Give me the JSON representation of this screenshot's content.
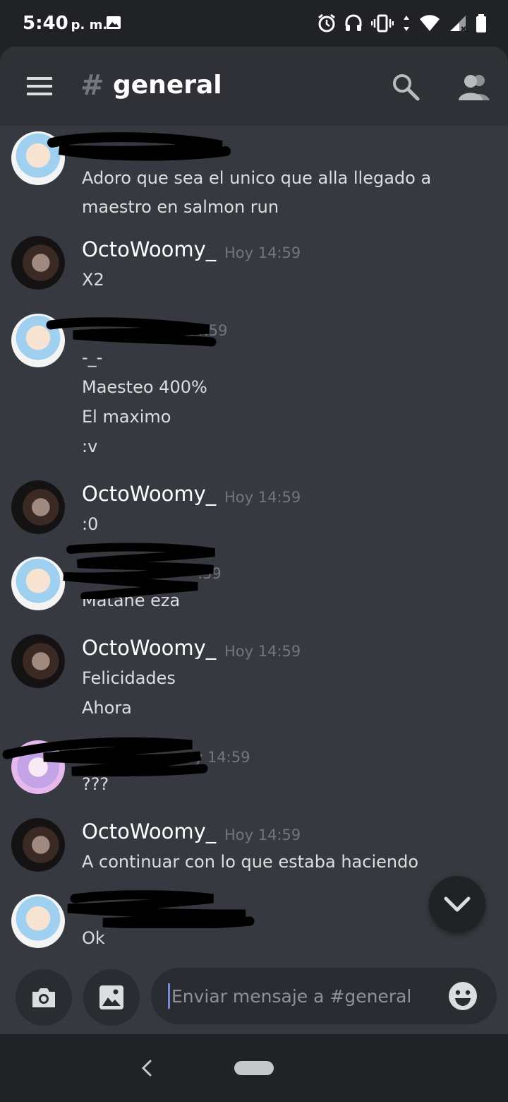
{
  "status_bar": {
    "time": "5:40",
    "ampm": "p. m."
  },
  "header": {
    "hash": "#",
    "channel": "general"
  },
  "messages": [
    {
      "author": "",
      "time": "",
      "lines": [
        "Adoro que sea el unico que alla llegado a",
        "maestro en salmon run"
      ]
    },
    {
      "author": "OctoWoomy_",
      "time": "Hoy 14:59",
      "lines": [
        "X2"
      ]
    },
    {
      "author": "",
      "time": "14:59",
      "lines": [
        "-_-",
        "Maesteo 400%",
        "El maximo",
        ":v"
      ]
    },
    {
      "author": "OctoWoomy_",
      "time": "Hoy 14:59",
      "lines": [
        ":0"
      ]
    },
    {
      "author": "",
      "time": ":59",
      "lines": [
        "Matane eza"
      ]
    },
    {
      "author": "OctoWoomy_",
      "time": "Hoy 14:59",
      "lines": [
        "Felicidades",
        "Ahora"
      ]
    },
    {
      "author": "",
      "time": "oy 14:59",
      "lines": [
        "???"
      ]
    },
    {
      "author": "OctoWoomy_",
      "time": "Hoy 14:59",
      "lines": [
        "A continuar con lo que estaba haciendo"
      ]
    },
    {
      "author": "",
      "time": "",
      "lines": [
        "Ok"
      ]
    }
  ],
  "composer": {
    "placeholder": "Enviar mensaje a #general"
  },
  "icons": {
    "menu": "hamburger-menu-icon",
    "search": "search-icon",
    "members": "members-icon",
    "camera": "camera-icon",
    "gallery": "image-icon",
    "emoji": "emoji-icon",
    "jump": "chevron-down-icon",
    "back": "back-icon",
    "home": "home-pill"
  },
  "colors": {
    "chat_bg": "#36393f",
    "header_bg": "#2f3136",
    "system_bg": "#202225",
    "accent": "#7289da"
  }
}
